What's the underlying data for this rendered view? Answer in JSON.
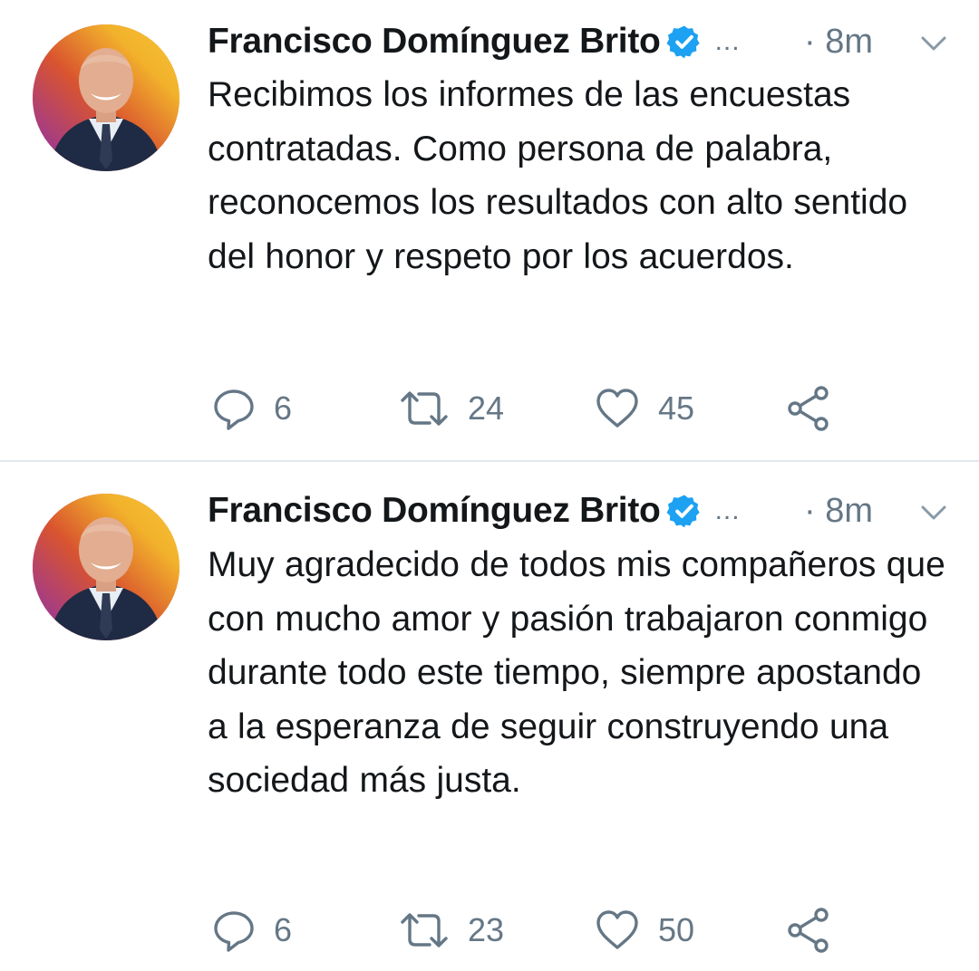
{
  "colors": {
    "verified": "#1da1f2",
    "secondary_text": "#657786",
    "primary_text": "#14171a",
    "divider": "#e1e8ed"
  },
  "tweets": [
    {
      "author": "Francisco Domínguez Brito",
      "ellipsis": "...",
      "time": "· 8m",
      "text": "Recibimos los informes de las encuestas contratadas. Como persona de palabra, reconocemos los resultados con alto sentido del honor y respeto por los acuerdos.",
      "reply_count": "6",
      "retweet_count": "24",
      "like_count": "45",
      "icons": [
        "avatar",
        "verified-badge-icon",
        "caret-down-icon",
        "reply-icon",
        "retweet-icon",
        "like-icon",
        "share-icon"
      ]
    },
    {
      "author": "Francisco Domínguez Brito",
      "ellipsis": "...",
      "time": "· 8m",
      "text": "Muy agradecido de todos mis compañeros  que con mucho amor y pasión trabajaron conmigo durante todo este tiempo, siempre apostando a la esperanza de seguir construyendo una sociedad más justa.",
      "reply_count": "6",
      "retweet_count": "23",
      "like_count": "50",
      "icons": [
        "avatar",
        "verified-badge-icon",
        "caret-down-icon",
        "reply-icon",
        "retweet-icon",
        "like-icon",
        "share-icon"
      ]
    }
  ]
}
